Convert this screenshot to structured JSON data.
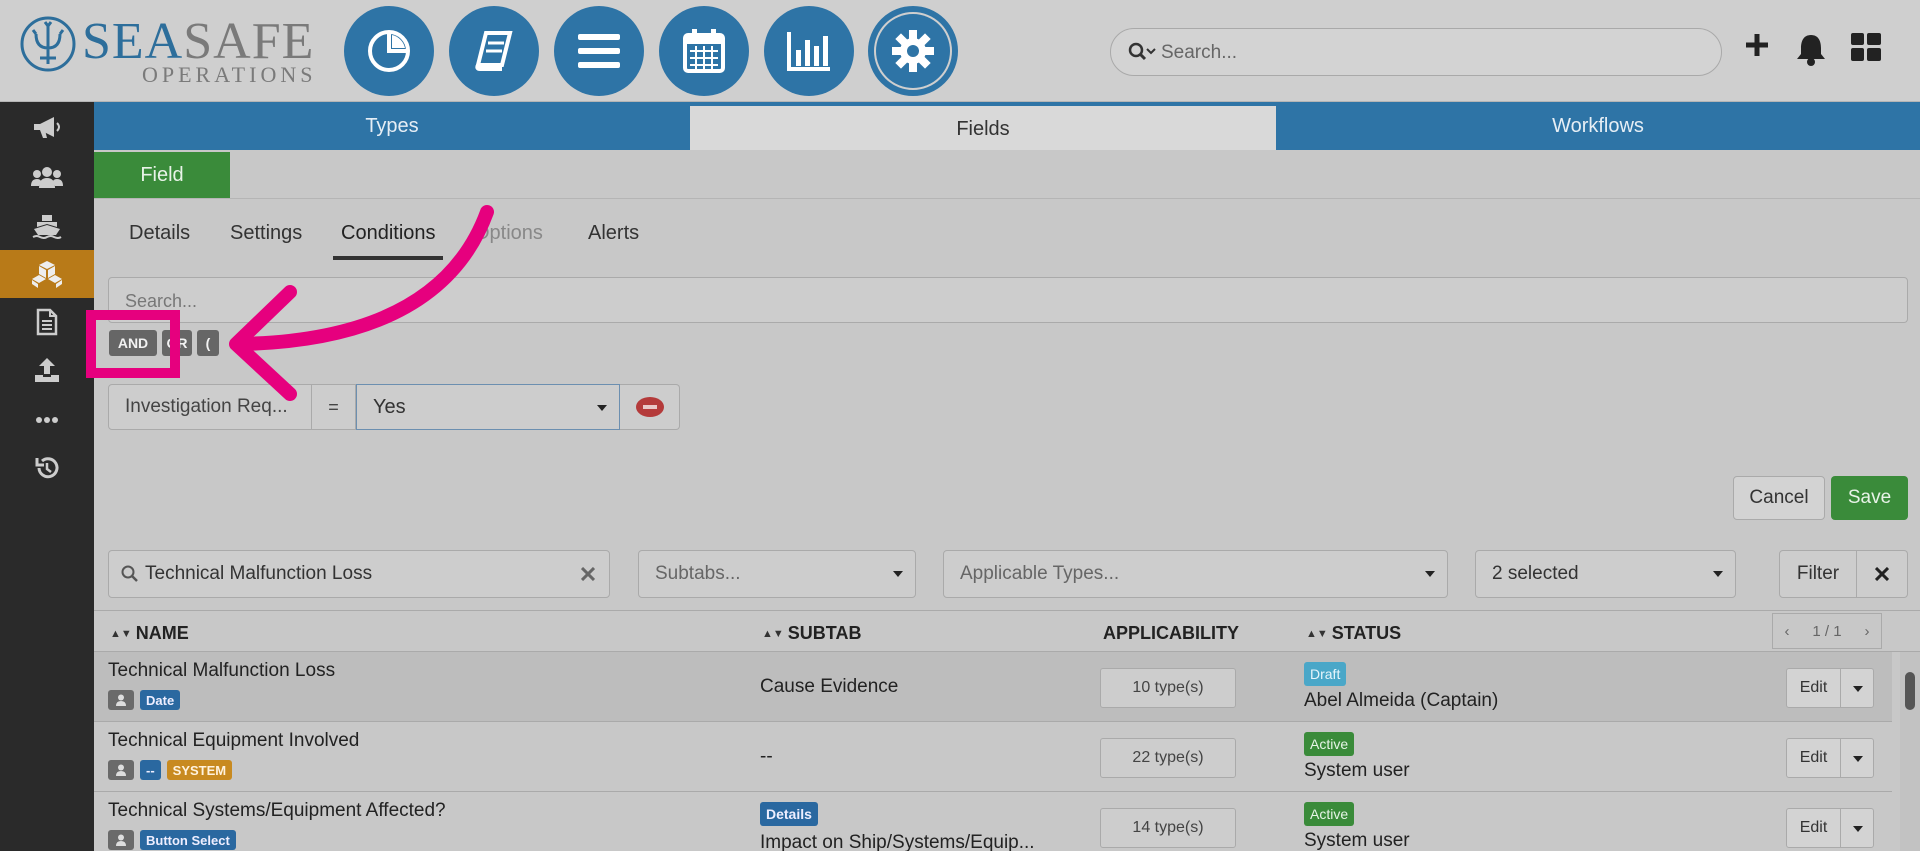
{
  "app": {
    "logo_main_a": "SEA",
    "logo_main_b": "SAFE",
    "logo_sub": "OPERATIONS"
  },
  "header": {
    "nav_icons": [
      "dashboard-pie-icon",
      "logbook-icon",
      "list-menu-icon",
      "calendar-icon",
      "bar-chart-icon",
      "gear-icon"
    ],
    "search_placeholder": "Search...",
    "icons": [
      "plus-icon",
      "bell-icon",
      "grid-icon"
    ]
  },
  "sidebar": {
    "items": [
      {
        "icon": "megaphone-icon",
        "active": false
      },
      {
        "icon": "users-icon",
        "active": false
      },
      {
        "icon": "ship-icon",
        "active": false
      },
      {
        "icon": "cubes-icon",
        "active": true
      },
      {
        "icon": "document-icon",
        "active": false
      },
      {
        "icon": "upload-icon",
        "active": false
      },
      {
        "icon": "more-icon",
        "active": false
      },
      {
        "icon": "history-icon",
        "active": false
      }
    ]
  },
  "main_tabs": {
    "types": "Types",
    "fields": "Fields",
    "workflows": "Workflows"
  },
  "field_button": "Field",
  "sub_tabs": {
    "details": "Details",
    "settings": "Settings",
    "conditions": "Conditions",
    "options": "Options",
    "alerts": "Alerts"
  },
  "conditions": {
    "search_placeholder": "Search...",
    "ops": {
      "and": "AND",
      "or": "OR",
      "paren": "("
    },
    "field": "Investigation Req...",
    "operator": "=",
    "value": "Yes"
  },
  "actions": {
    "cancel": "Cancel",
    "save": "Save"
  },
  "filters": {
    "name_value": "Technical Malfunction Loss",
    "subtabs_placeholder": "Subtabs...",
    "types_placeholder": "Applicable Types...",
    "status_value": "2 selected",
    "filter_label": "Filter",
    "clear_icon": "times-icon"
  },
  "table": {
    "columns": {
      "name": "NAME",
      "subtab": "SUBTAB",
      "applicability": "APPLICABILITY",
      "status": "STATUS"
    },
    "pager": "1 / 1",
    "rows": [
      {
        "name": "Technical Malfunction Loss",
        "tags": [
          "Date"
        ],
        "subtab": "Cause Evidence",
        "applicability": "10 type(s)",
        "status": "Draft",
        "user": "Abel Almeida (Captain)",
        "edit": "Edit"
      },
      {
        "name": "Technical Equipment Involved",
        "tags": [
          "--",
          "SYSTEM"
        ],
        "subtab": "--",
        "applicability": "22 type(s)",
        "status": "Active",
        "user": "System user",
        "edit": "Edit"
      },
      {
        "name": "Technical Systems/Equipment Affected?",
        "tags": [
          "Button Select"
        ],
        "subtab_chip": "Details",
        "subtab": "Impact on Ship/Systems/Equip...",
        "applicability": "14 type(s)",
        "status": "Active",
        "user": "System user",
        "edit": "Edit"
      }
    ]
  },
  "annotation": {
    "highlight_color": "#e6007e"
  }
}
